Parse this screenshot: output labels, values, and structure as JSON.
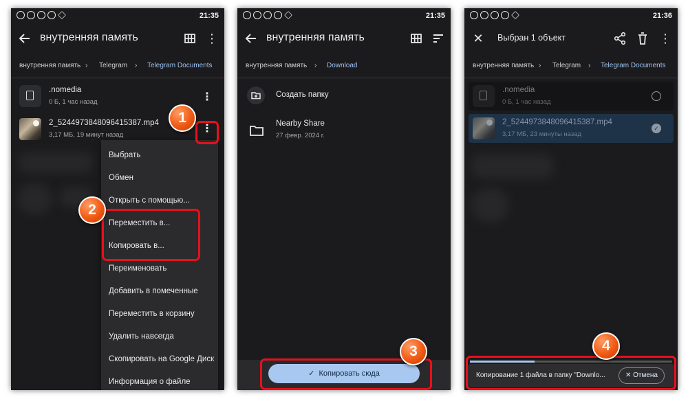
{
  "panel1": {
    "time": "21:35",
    "title": "внутренняя память",
    "crumbs": [
      "внутренняя память",
      "Telegram",
      "Telegram Documents"
    ],
    "files": [
      {
        "name": ".nomedia",
        "meta": "0 Б, 1 час назад"
      },
      {
        "name": "2_5244973848096415387.mp4",
        "meta": "3,17 МБ, 19 минут назад"
      }
    ],
    "menu": [
      "Выбрать",
      "Обмен",
      "Открыть с помощью...",
      "Переместить в...",
      "Копировать в...",
      "Переименовать",
      "Добавить в помеченные",
      "Переместить в корзину",
      "Удалить навсегда",
      "Скопировать на Google Диск",
      "Информация о файле"
    ],
    "badges": [
      "1",
      "2"
    ]
  },
  "panel2": {
    "time": "21:35",
    "title": "внутренняя память",
    "crumbs": [
      "внутренняя память",
      "Download"
    ],
    "create_folder": "Создать папку",
    "folder": {
      "name": "Nearby Share",
      "date": "27 февр. 2024 г."
    },
    "copy_button": "Копировать сюда",
    "badge": "3"
  },
  "panel3": {
    "time": "21:36",
    "title": "Выбран 1 объект",
    "crumbs": [
      "внутренняя память",
      "Telegram",
      "Telegram Documents"
    ],
    "files": [
      {
        "name": ".nomedia",
        "meta": "0 Б, 1 час назад"
      },
      {
        "name": "2_5244973848096415387.mp4",
        "meta": "3,17 МБ, 23 минуты назад"
      }
    ],
    "snackbar_text": "Копирование 1 файла в папку \"Downlo...",
    "cancel_label": "Отмена",
    "progress": 0.32,
    "badge": "4"
  },
  "colors": {
    "accent": "#a9c8ef",
    "highlight": "#e8101b",
    "badge": "#f05a14"
  }
}
